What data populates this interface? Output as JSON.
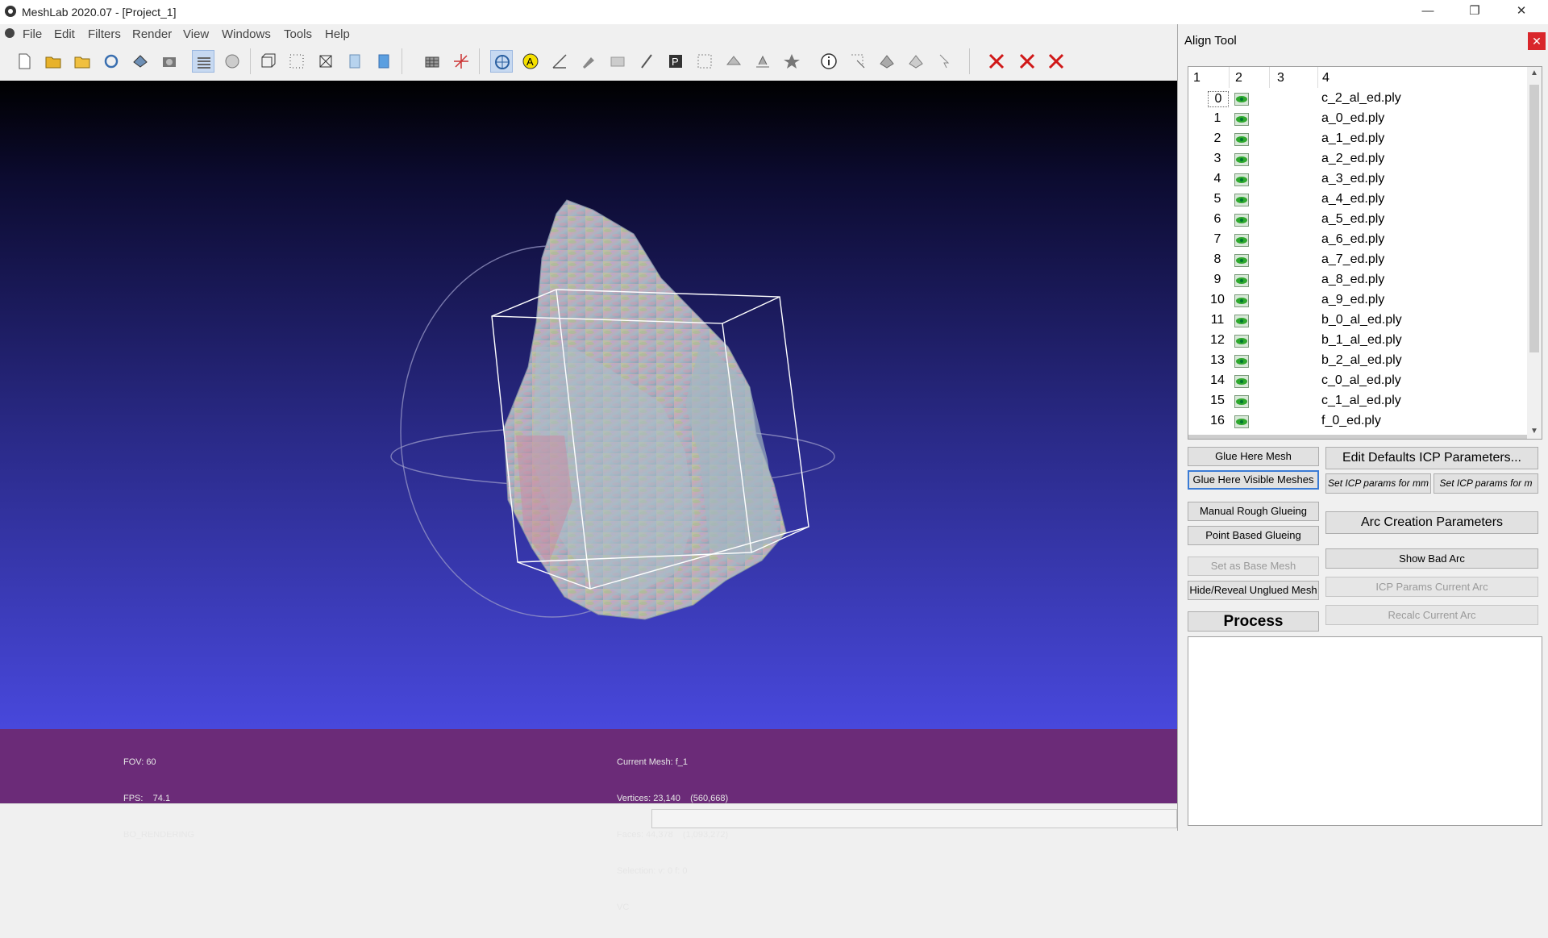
{
  "window": {
    "title": "MeshLab 2020.07 - [Project_1]",
    "minimize": "—",
    "restore": "❐",
    "close": "✕"
  },
  "menu": [
    "File",
    "Edit",
    "Filters",
    "Render",
    "View",
    "Windows",
    "Tools",
    "Help"
  ],
  "viewport_info": {
    "left": [
      "FOV: 60",
      "FPS:    74.1",
      "BO_RENDERING"
    ],
    "right": [
      "Current Mesh: f_1",
      "Vertices: 23,140    (560,668)",
      "Faces: 44,378    (1,093,272)",
      "Selection: v: 0 f: 0",
      "VC"
    ]
  },
  "align_tool": {
    "title": "Align Tool",
    "close": "✕",
    "columns": [
      "1",
      "2",
      "3",
      "4"
    ],
    "rows": [
      {
        "idx": "0",
        "name": "c_2_al_ed.ply"
      },
      {
        "idx": "1",
        "name": "a_0_ed.ply"
      },
      {
        "idx": "2",
        "name": "a_1_ed.ply"
      },
      {
        "idx": "3",
        "name": "a_2_ed.ply"
      },
      {
        "idx": "4",
        "name": "a_3_ed.ply"
      },
      {
        "idx": "5",
        "name": "a_4_ed.ply"
      },
      {
        "idx": "6",
        "name": "a_5_ed.ply"
      },
      {
        "idx": "7",
        "name": "a_6_ed.ply"
      },
      {
        "idx": "8",
        "name": "a_7_ed.ply"
      },
      {
        "idx": "9",
        "name": "a_8_ed.ply"
      },
      {
        "idx": "10",
        "name": "a_9_ed.ply"
      },
      {
        "idx": "11",
        "name": "b_0_al_ed.ply"
      },
      {
        "idx": "12",
        "name": "b_1_al_ed.ply"
      },
      {
        "idx": "13",
        "name": "b_2_al_ed.ply"
      },
      {
        "idx": "14",
        "name": "c_0_al_ed.ply"
      },
      {
        "idx": "15",
        "name": "c_1_al_ed.ply"
      },
      {
        "idx": "16",
        "name": "f_0_ed.ply"
      }
    ],
    "buttons": {
      "glue_here_mesh": "Glue Here Mesh",
      "glue_here_visible": "Glue Here Visible Meshes",
      "manual_rough": "Manual Rough Glueing",
      "point_based": "Point Based Glueing",
      "set_base": "Set as Base Mesh",
      "hide_reveal": "Hide/Reveal Unglued Mesh",
      "process": "Process",
      "edit_defaults": "Edit Defaults ICP Parameters...",
      "icp_mm": "Set ICP params for mm",
      "icp_m": "Set ICP params for m",
      "arc_creation": "Arc Creation Parameters",
      "show_bad_arc": "Show Bad Arc",
      "icp_current_arc": "ICP Params Current Arc",
      "recalc_current_arc": "Recalc Current Arc"
    }
  }
}
